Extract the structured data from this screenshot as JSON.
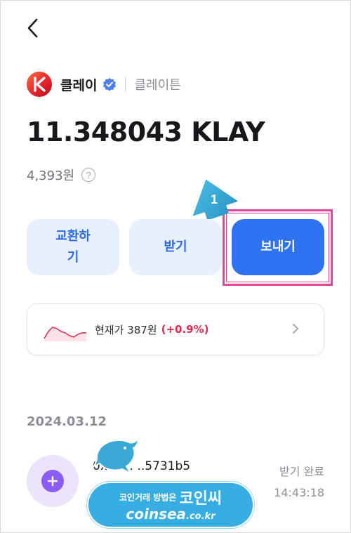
{
  "coin": {
    "name": "클레이",
    "network": "클레이튼",
    "balance": "11.348043 KLAY",
    "krw_value": "4,393원",
    "help_glyph": "?"
  },
  "actions": {
    "exchange_label": "교환하\n기",
    "receive_label": "받기",
    "send_label": "보내기"
  },
  "annotation": {
    "step_number": "1",
    "highlight_color": "#e8429a",
    "badge_color": "#3aa9d6"
  },
  "price": {
    "label": "현재가 387원",
    "change": "(+0.9%)"
  },
  "history": {
    "date": "2024.03.12",
    "items": [
      {
        "address": "0x1c… ..5731b5",
        "status": "받기 완료",
        "time": "14:43:18",
        "icon": "plus-icon"
      }
    ]
  },
  "watermark": {
    "line1_small": "코인거래 방법은",
    "line1_big": "코인씨",
    "url_main": "coinsea",
    "url_tail": ".co.kr"
  },
  "colors": {
    "accent": "#2e73f3",
    "accent_light": "#e6f0fe",
    "positive": "#e0284f",
    "tx_icon": "#8b5cf6"
  },
  "icons": [
    "back-arrow-icon",
    "klay-logo-icon",
    "verified-badge-icon",
    "help-icon",
    "sparkline-icon",
    "chevron-right-icon",
    "plus-icon"
  ]
}
